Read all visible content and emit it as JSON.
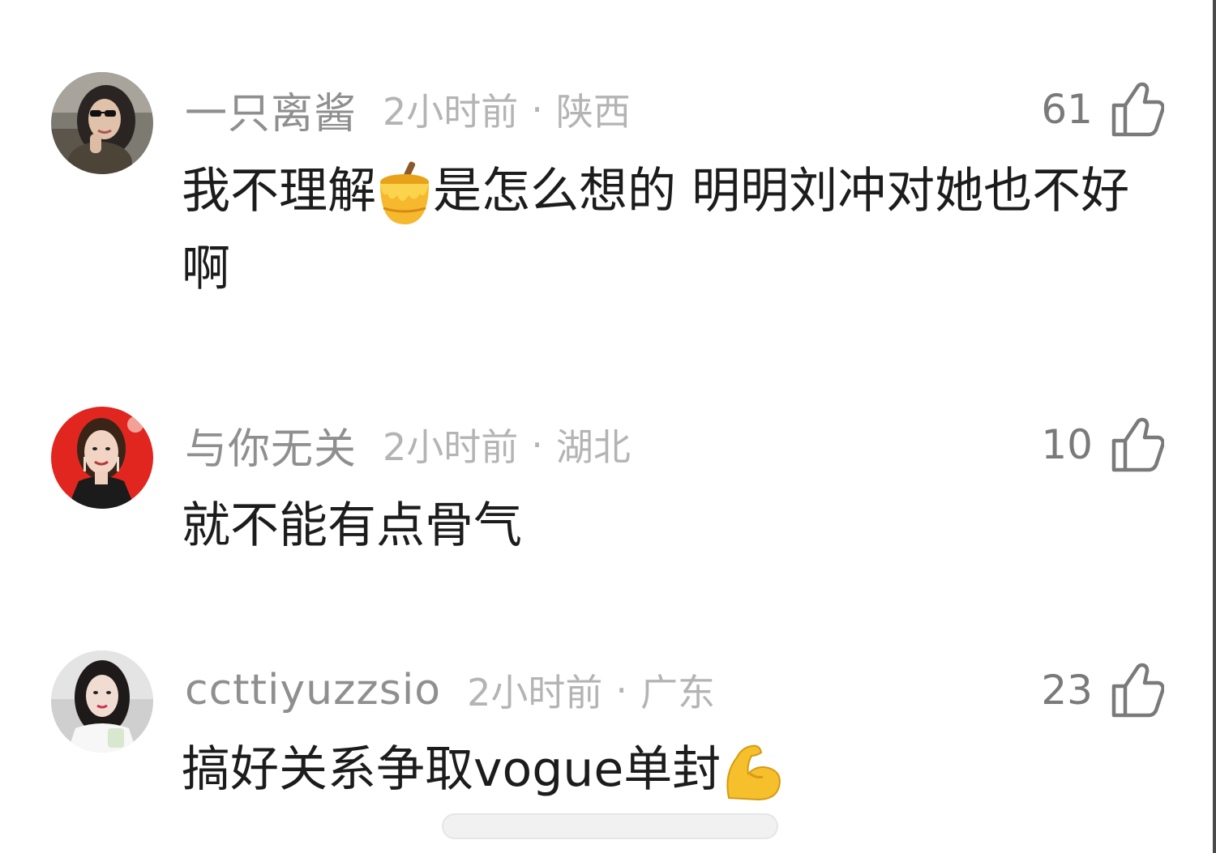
{
  "comments": [
    {
      "username": "一只离酱",
      "time": "2小时前",
      "separator": "·",
      "location": "陕西",
      "likes": "61",
      "text_before_emoji": "我不理解",
      "emoji": "honey-pot",
      "text_after_emoji": "是怎么想的 明明刘冲对她也不好啊"
    },
    {
      "username": "与你无关",
      "time": "2小时前",
      "separator": "·",
      "location": "湖北",
      "likes": "10",
      "text": "就不能有点骨气"
    },
    {
      "username": "ccttiyuzzsio",
      "time": "2小时前",
      "separator": "·",
      "location": "广东",
      "likes": "23",
      "text": "搞好关系争取vogue单封",
      "emoji": "flexed-biceps"
    }
  ],
  "colors": {
    "username": "#8f8f8f",
    "meta": "#b4b4b4",
    "content": "#1c1c1c",
    "likes": "#7a7a7a"
  }
}
